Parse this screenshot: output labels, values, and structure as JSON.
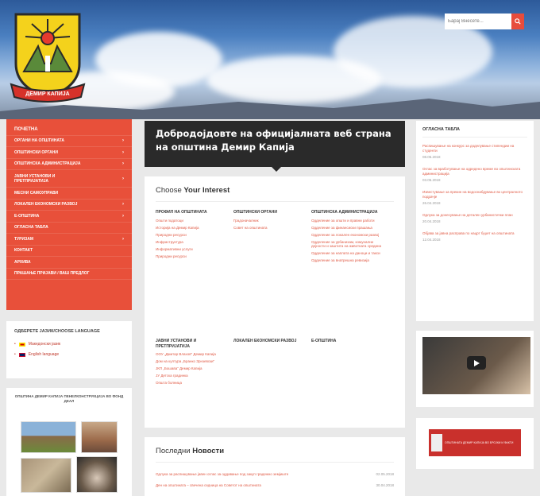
{
  "search": {
    "placeholder": "Барај Внесете..."
  },
  "logo": {
    "label": "ДЕМИР КАПИЈА"
  },
  "menu": [
    {
      "label": "ПОЧЕТНА",
      "arrow": ""
    },
    {
      "label": "ОРГАНИ НА ОПШТИНАТА",
      "arrow": "›"
    },
    {
      "label": "ОПШТИНСКИ ОРГАНИ",
      "arrow": "›"
    },
    {
      "label": "ОПШТИНСКА АДМИНИСТРАЦИЈА",
      "arrow": "›"
    },
    {
      "label": "ЈАВНИ УСТАНОВИ И ПРЕТПРИЈАТИЈА",
      "arrow": "›"
    },
    {
      "label": "МЕСНИ САМОУПРАВИ",
      "arrow": ""
    },
    {
      "label": "ЛОКАЛЕН ЕКОНОМСКИ РАЗВОЈ",
      "arrow": "›"
    },
    {
      "label": "Е-ОПШТИНА",
      "arrow": "›"
    },
    {
      "label": "ОГЛАСНА ТАБЛА",
      "arrow": ""
    },
    {
      "label": "ТУРИЗАМ",
      "arrow": "›"
    },
    {
      "label": "КОНТАКТ",
      "arrow": ""
    },
    {
      "label": "АРХИВА",
      "arrow": ""
    },
    {
      "label": "ПРАШАЊЕ ПРИЈАВИ / ВАШ ПРЕДЛОГ",
      "arrow": ""
    }
  ],
  "lang": {
    "title": "ОДБЕРЕТЕ ЈАЗИК/CHOOSE LANGUAGE",
    "items": [
      "Македонски јазик",
      "English language"
    ]
  },
  "gallery": {
    "title": "ОПШТИНА ДЕМИР КАПИЈА ПЕНЕЛКОНСТРУКЦИЈА ВО ФОНД ДЕАЛ"
  },
  "welcome": {
    "title": "Добродојдовте на официјалната веб страна на општина Демир Капија"
  },
  "interest": {
    "title_plain": "Choose ",
    "title_bold": "Your Interest",
    "columns": [
      {
        "head": "ПРОФИЛ НА ОПШТИНАТА",
        "links": [
          "Општи податоци",
          "Историја на Демир Капија",
          "Природни ресурси",
          "Инфраструктура",
          "Информативни услуги",
          "Природни ресурси"
        ]
      },
      {
        "head": "ОПШТИНСКИ ОРГАНИ",
        "links": [
          "Градоначалник",
          "Совет на општината"
        ]
      },
      {
        "head": "ОПШТИНСКА АДМИНИСТРАЦИЈА",
        "links": [
          "Одделение за општи и правни работи",
          "Одделение за финансиски прашања",
          "Одделение за локален економски развој",
          "Одделение за урбанизам, комунални дејности и заштита на животната средина",
          "Одделение за наплата на даноци и такси",
          "Одделение за внатрешна ревизија"
        ]
      },
      {
        "head": "ЈАВНИ УСТАНОВИ И ПРЕТПРИЈАТИЈА",
        "links": [
          "ООУ „Дмитар Влахов“ Демир Капија",
          "Дом на култура „Бранко Зрнзевски“",
          "ЈКП „Бошава“ Демир Капија",
          "ЈУ Детска градинка",
          "Општа болница"
        ]
      },
      {
        "head": "ЛОКАЛЕН ЕКОНОМСКИ РАЗВОЈ",
        "links": []
      },
      {
        "head": "Е-ОПШТИНА",
        "links": []
      }
    ]
  },
  "news": {
    "title_plain": "Последни ",
    "title_bold": "Новости",
    "items": [
      {
        "title": "Одлука за распишување јавен оглас за оддавање под закуп градежно земјиште",
        "date": "02.05.2018"
      },
      {
        "title": "Ден на општината – свечена седница на Советот на општината",
        "date": "30.04.2018"
      }
    ]
  },
  "board": {
    "title": "ОГЛАСНА ТАБЛА",
    "items": [
      {
        "title": "Распишување на конкурс за доделување стипендии на студенти",
        "date": "08.05.2018"
      },
      {
        "title": "Оглас за вработување на одредено време во општинската администрација",
        "date": "03.05.2018"
      },
      {
        "title": "Известување за прекин на водоснабдување во централното подрачје",
        "date": "26.04.2018"
      },
      {
        "title": "Одлука за донесување на детален урбанистички план",
        "date": "20.04.2018"
      },
      {
        "title": "Објава за јавна расправа по нацрт буџет на општината",
        "date": "12.04.2018"
      }
    ]
  },
  "banner": {
    "text": "ОПШТИНАТА ДЕМИР КАПИЈА ВО БРОЈКИ И ФАКТИ"
  },
  "colors": {
    "accent": "#e8503a",
    "dark": "#2a2a2a",
    "link": "#e05a45"
  }
}
